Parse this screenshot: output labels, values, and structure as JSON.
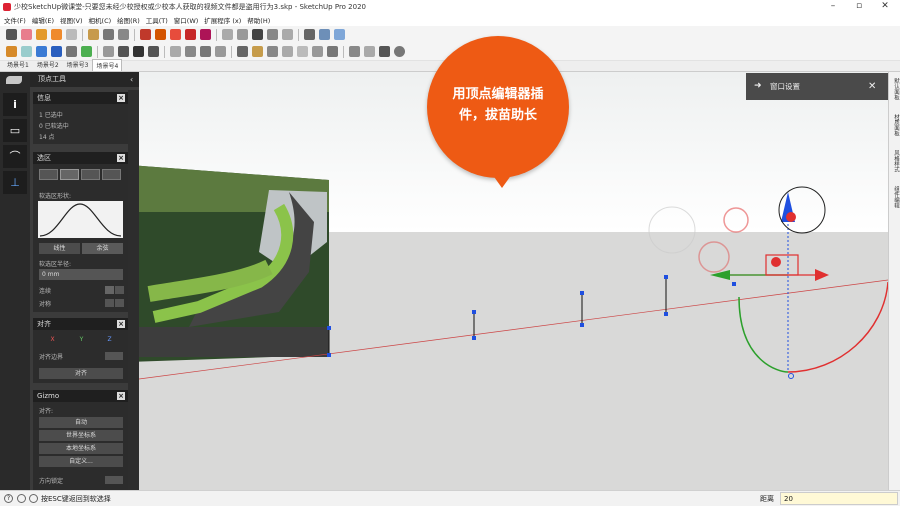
{
  "window": {
    "title": "少校SketchUp微课堂-只要您未经少校授权或少校本人获取的视频文件都是盗用行为3.skp - SketchUp Pro 2020",
    "min": "–",
    "max": "▫",
    "close": "✕"
  },
  "menu": [
    "文件(F)",
    "编辑(E)",
    "视图(V)",
    "相机(C)",
    "绘图(R)",
    "工具(T)",
    "窗口(W)",
    "扩展程序 (x)",
    "帮助(H)"
  ],
  "scenes": [
    "场景号1",
    "场景号2",
    "场景号3",
    "场景号4"
  ],
  "panel": {
    "title": "顶点工具",
    "info": {
      "header": "信息",
      "line1": "1 已选中",
      "line2": "0 已软选中",
      "line3": "14 点"
    },
    "select": {
      "header": "选区",
      "curve_label": "软选区形状:",
      "btn1": "线性",
      "btn2": "余弦",
      "radius_label": "软选区半径:",
      "radius_value": "0 mm",
      "opt1": "连续",
      "opt2": "对称"
    },
    "align": {
      "header": "对齐",
      "x": "X",
      "y": "Y",
      "z": "Z",
      "bbox": "对齐边界",
      "apply": "对齐"
    },
    "gizmo": {
      "header": "Gizmo",
      "orient": "对齐:",
      "b1": "自动",
      "b2": "世界坐标系",
      "b3": "本地坐标系",
      "b4": "自定义...",
      "lock": "方向锁定"
    }
  },
  "tray": {
    "title": "窗口设置",
    "close": "✕"
  },
  "right_tabs": [
    "默认面板",
    "材质面板",
    "风格样式",
    "组件编辑"
  ],
  "callout": {
    "line1": "用顶点编辑器插",
    "line2": "件，拔苗助长"
  },
  "status": {
    "hint": "按ESC键返回到软选择",
    "dist_label": "距离",
    "dist_value": "20"
  },
  "colors": {
    "accent": "#ee5a14",
    "panel": "#3b3b3b",
    "green": "#2ca02c",
    "red": "#e03030",
    "blue": "#1f4fe0"
  }
}
